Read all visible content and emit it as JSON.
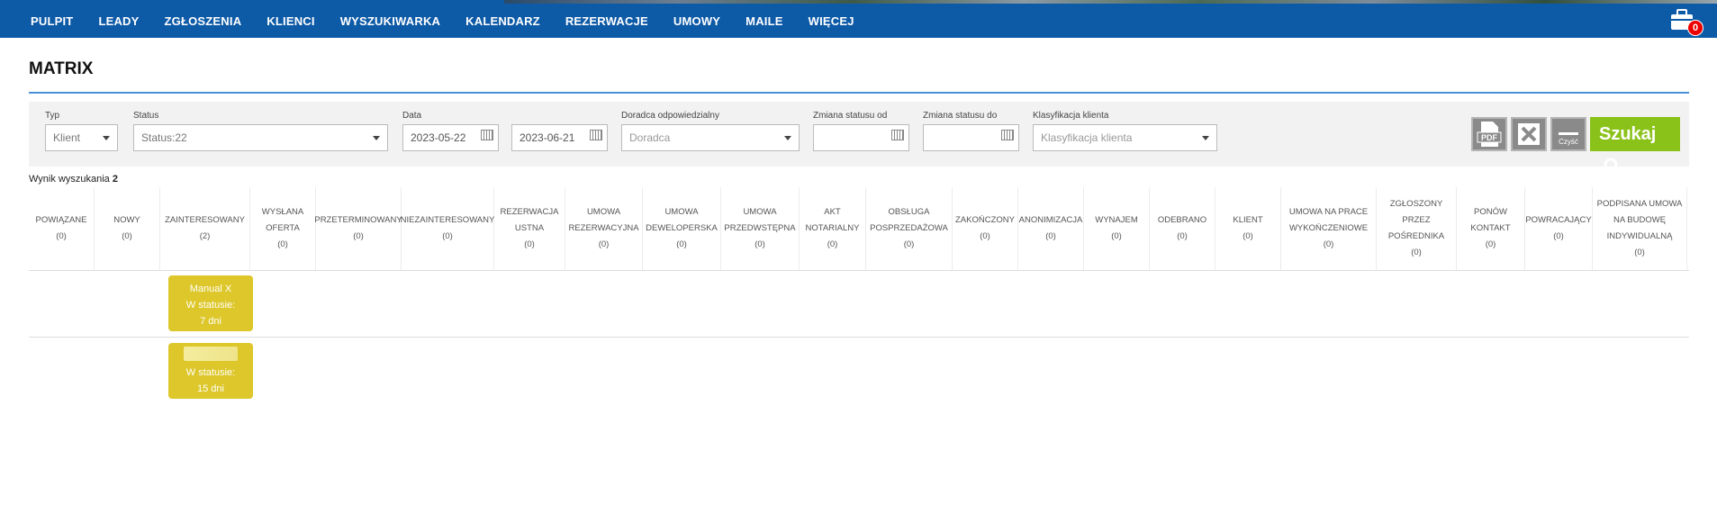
{
  "nav": {
    "items": [
      "PULPIT",
      "LEADY",
      "ZGŁOSZENIA",
      "KLIENCI",
      "WYSZUKIWARKA",
      "KALENDARZ",
      "REZERWACJE",
      "UMOWY",
      "MAILE",
      "WIĘCEJ"
    ],
    "notifications_count": "0"
  },
  "page": {
    "title": "MATRIX"
  },
  "filters": {
    "typ": {
      "label": "Typ",
      "value": "Klient"
    },
    "status": {
      "label": "Status",
      "value": "Status:22"
    },
    "data": {
      "label": "Data",
      "from": "2023-05-22",
      "to": "2023-06-21"
    },
    "doradca": {
      "label": "Doradca odpowiedzialny",
      "placeholder": "Doradca"
    },
    "zmiana_od": {
      "label": "Zmiana statusu od",
      "value": ""
    },
    "zmiana_do": {
      "label": "Zmiana statusu do",
      "value": ""
    },
    "klasyfikacja": {
      "label": "Klasyfikacja klienta",
      "placeholder": "Klasyfikacja klienta"
    },
    "buttons": {
      "pdf": "PDF",
      "clear": "Czyść",
      "search": "Szukaj"
    }
  },
  "results": {
    "label": "Wynik wyszukania",
    "count": "2"
  },
  "columns": [
    {
      "name": "POWIĄZANE",
      "count": "(0)"
    },
    {
      "name": "NOWY",
      "count": "(0)"
    },
    {
      "name": "ZAINTERESOWANY",
      "count": "(2)"
    },
    {
      "name": "WYSŁANA OFERTA",
      "count": "(0)"
    },
    {
      "name": "PRZETERMINOWANY",
      "count": "(0)"
    },
    {
      "name": "NIEZAINTERESOWANY",
      "count": "(0)"
    },
    {
      "name": "REZERWACJA USTNA",
      "count": "(0)"
    },
    {
      "name": "UMOWA REZERWACYJNA",
      "count": "(0)"
    },
    {
      "name": "UMOWA DEWELOPERSKA",
      "count": "(0)"
    },
    {
      "name": "UMOWA PRZEDWSTĘPNA",
      "count": "(0)"
    },
    {
      "name": "AKT NOTARIALNY",
      "count": "(0)"
    },
    {
      "name": "OBSŁUGA POSPRZEDAŻOWA",
      "count": "(0)"
    },
    {
      "name": "ZAKOŃCZONY",
      "count": "(0)"
    },
    {
      "name": "ANONIMIZACJA",
      "count": "(0)"
    },
    {
      "name": "WYNAJEM",
      "count": "(0)"
    },
    {
      "name": "ODEBRANO",
      "count": "(0)"
    },
    {
      "name": "KLIENT",
      "count": "(0)"
    },
    {
      "name": "UMOWA NA PRACE WYKOŃCZENIOWE",
      "count": "(0)"
    },
    {
      "name": "ZGŁOSZONY PRZEZ POŚREDNIKA",
      "count": "(0)"
    },
    {
      "name": "PONÓW KONTAKT",
      "count": "(0)"
    },
    {
      "name": "POWRACAJĄCY",
      "count": "(0)"
    },
    {
      "name": "PODPISANA UMOWA NA BUDOWĘ INDYWIDUALNĄ",
      "count": "(0)"
    }
  ],
  "cards": [
    {
      "name": "Manual X",
      "status_label": "W statusie:",
      "days": "7 dni"
    },
    {
      "name": "",
      "status_label": "W statusie:",
      "days": "15 dni"
    }
  ]
}
